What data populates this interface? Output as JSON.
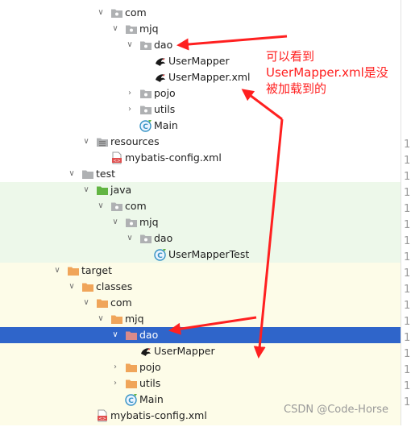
{
  "tree": [
    {
      "label": "com",
      "icon": "package-folder-icon",
      "expanded": true
    },
    {
      "label": "mjq",
      "icon": "package-folder-icon",
      "expanded": true
    },
    {
      "label": "dao",
      "icon": "package-folder-icon",
      "expanded": true
    },
    {
      "label": "UserMapper",
      "icon": "mybatis-bird-icon"
    },
    {
      "label": "UserMapper.xml",
      "icon": "mybatis-bird-icon"
    },
    {
      "label": "pojo",
      "icon": "package-folder-icon",
      "expanded": false
    },
    {
      "label": "utils",
      "icon": "package-folder-icon",
      "expanded": false
    },
    {
      "label": "Main",
      "icon": "java-class-icon"
    },
    {
      "label": "resources",
      "icon": "resources-folder-icon",
      "expanded": true
    },
    {
      "label": "mybatis-config.xml",
      "icon": "xml-file-icon"
    },
    {
      "label": "test",
      "icon": "folder-icon",
      "expanded": true
    },
    {
      "label": "java",
      "icon": "test-source-folder-icon",
      "expanded": true
    },
    {
      "label": "com",
      "icon": "package-folder-icon",
      "expanded": true
    },
    {
      "label": "mjq",
      "icon": "package-folder-icon",
      "expanded": true
    },
    {
      "label": "dao",
      "icon": "package-folder-icon",
      "expanded": true
    },
    {
      "label": "UserMapperTest",
      "icon": "java-class-icon"
    },
    {
      "label": "target",
      "icon": "excluded-folder-icon",
      "expanded": true
    },
    {
      "label": "classes",
      "icon": "excluded-folder-icon",
      "expanded": true
    },
    {
      "label": "com",
      "icon": "excluded-folder-icon",
      "expanded": true
    },
    {
      "label": "mjq",
      "icon": "excluded-folder-icon",
      "expanded": true
    },
    {
      "label": "dao",
      "icon": "excluded-folder-icon",
      "expanded": true,
      "selected": true
    },
    {
      "label": "UserMapper",
      "icon": "mybatis-bird-icon"
    },
    {
      "label": "pojo",
      "icon": "excluded-folder-icon",
      "expanded": false
    },
    {
      "label": "utils",
      "icon": "excluded-folder-icon",
      "expanded": false
    },
    {
      "label": "Main",
      "icon": "java-class-icon"
    },
    {
      "label": "mybatis-config.xml",
      "icon": "xml-file-icon"
    }
  ],
  "gutter": [
    "1",
    "1",
    "1",
    "1",
    "1",
    "1",
    "1",
    "1",
    "1",
    "1",
    "1",
    "1",
    "1",
    "1",
    "1",
    "1",
    "1"
  ],
  "annotation": {
    "lines": [
      "可以看到",
      "UserMapper.xml是没",
      "被加载到的"
    ]
  },
  "watermark": "CSDN @Code-Horse",
  "colors": {
    "selection": "#2f65ca",
    "arrow": "#ff2020",
    "test_bg": "#edf8ea",
    "target_bg": "#fdfce8"
  }
}
